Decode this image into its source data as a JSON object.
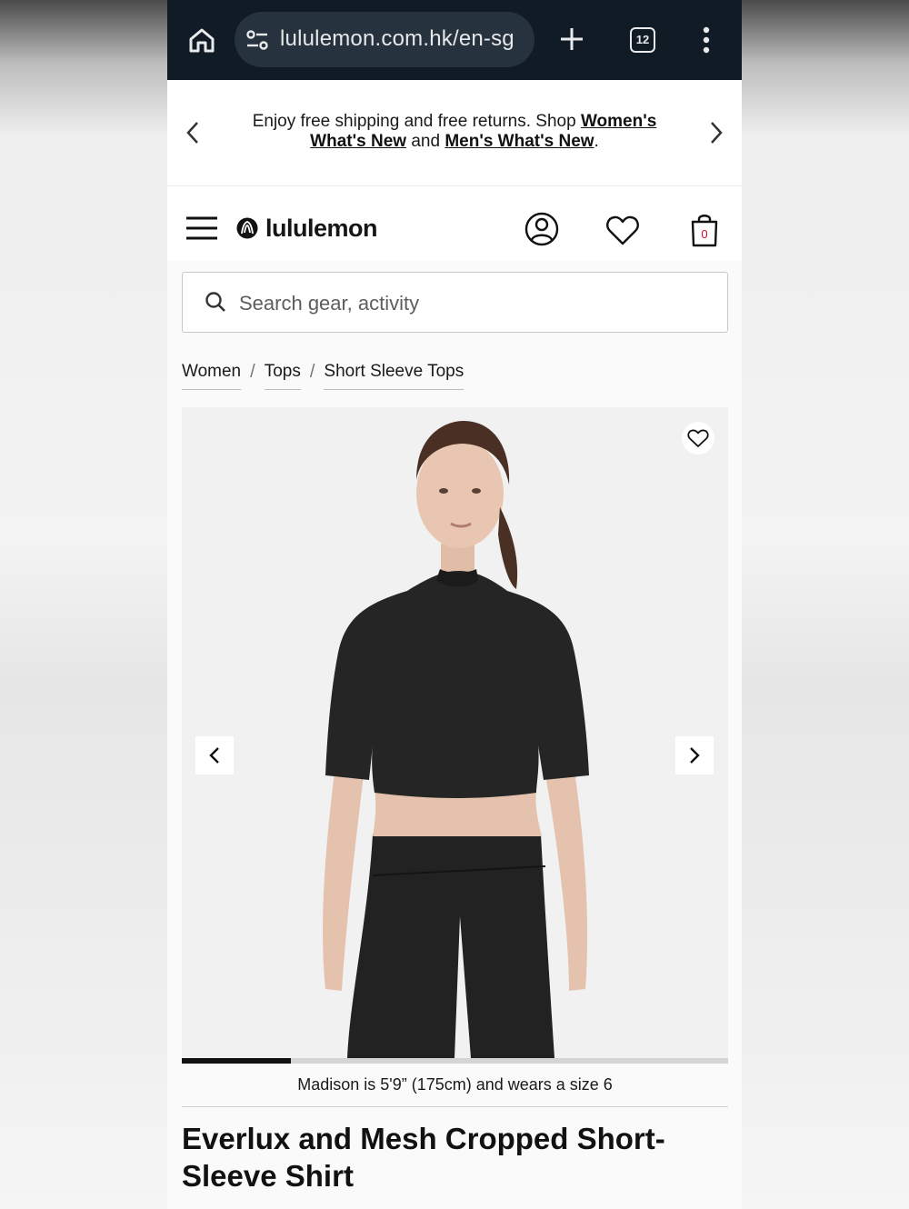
{
  "browser": {
    "url": "lululemon.com.hk/en-sg",
    "tab_count": "12",
    "icons": [
      "home-icon",
      "site-settings-icon",
      "new-tab-icon",
      "tabs-icon",
      "more-vert-icon"
    ]
  },
  "promo": {
    "text_before": "Enjoy free shipping and free returns. Shop ",
    "link_womens": "Women's What's New",
    "text_and": " and ",
    "link_mens": "Men's What's New",
    "text_end": "."
  },
  "header": {
    "logo_text": "lululemon",
    "bag_count": "0",
    "brand_color": "#c8102e"
  },
  "search": {
    "placeholder": "Search gear, activity"
  },
  "breadcrumb": {
    "items": [
      "Women",
      "Tops",
      "Short Sleeve Tops"
    ],
    "separator": "/"
  },
  "gallery": {
    "progress_fraction": 0.2,
    "caption": "Madison is 5'9” (175cm) and wears a size 6"
  },
  "product": {
    "title": "Everlux and Mesh Cropped Short-Sleeve Shirt"
  }
}
